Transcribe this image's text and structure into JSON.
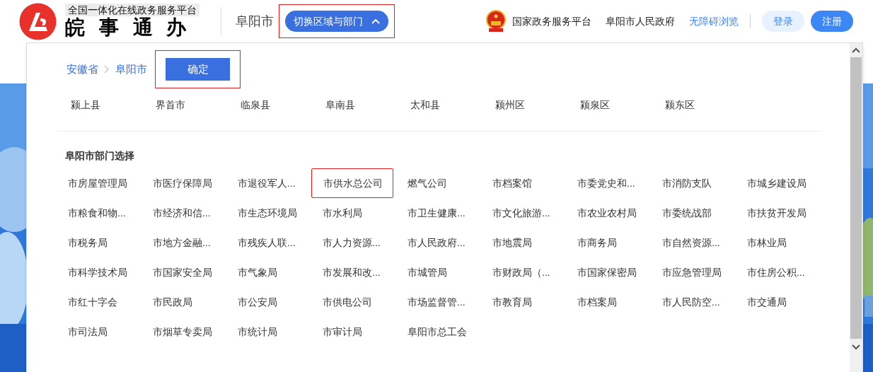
{
  "header": {
    "platform_tagline": "全国一体化在线政务服务平台",
    "brand": "皖 事 通 办",
    "current_city": "阜阳市",
    "switch_button": {
      "label": "切换区域与部门",
      "expanded": true,
      "highlighted": true
    },
    "links": [
      {
        "label": "国家政务服务平台",
        "kind": "emblem"
      },
      {
        "label": "阜阳市人民政府",
        "kind": "plain"
      },
      {
        "label": "无障碍浏览",
        "kind": "accent"
      }
    ],
    "login": "登录",
    "register": "注册"
  },
  "dropdown": {
    "breadcrumb": [
      "安徽省",
      "阜阳市"
    ],
    "confirm": {
      "label": "确定",
      "highlighted": true
    },
    "districts": [
      "颍上县",
      "界首市",
      "临泉县",
      "阜南县",
      "太和县",
      "颍州区",
      "颍泉区",
      "颍东区"
    ],
    "department_title": "阜阳市部门选择",
    "departments": [
      {
        "label": "市房屋管理局",
        "highlighted": false
      },
      {
        "label": "市医疗保障局",
        "highlighted": false
      },
      {
        "label": "市退役军人...",
        "highlighted": false
      },
      {
        "label": "市供水总公司",
        "highlighted": true
      },
      {
        "label": "燃气公司",
        "highlighted": false
      },
      {
        "label": "市档案馆",
        "highlighted": false
      },
      {
        "label": "市委党史和...",
        "highlighted": false
      },
      {
        "label": "市消防支队",
        "highlighted": false
      },
      {
        "label": "市城乡建设局",
        "highlighted": false
      },
      {
        "label": "市粮食和物...",
        "highlighted": false
      },
      {
        "label": "市经济和信...",
        "highlighted": false
      },
      {
        "label": "市生态环境局",
        "highlighted": false
      },
      {
        "label": "市水利局",
        "highlighted": false
      },
      {
        "label": "市卫生健康...",
        "highlighted": false
      },
      {
        "label": "市文化旅游...",
        "highlighted": false
      },
      {
        "label": "市农业农村局",
        "highlighted": false
      },
      {
        "label": "市委统战部",
        "highlighted": false
      },
      {
        "label": "市扶贫开发局",
        "highlighted": false
      },
      {
        "label": "市税务局",
        "highlighted": false
      },
      {
        "label": "市地方金融...",
        "highlighted": false
      },
      {
        "label": "市残疾人联...",
        "highlighted": false
      },
      {
        "label": "市人力资源...",
        "highlighted": false
      },
      {
        "label": "市人民政府...",
        "highlighted": false
      },
      {
        "label": "市地震局",
        "highlighted": false
      },
      {
        "label": "市商务局",
        "highlighted": false
      },
      {
        "label": "市自然资源...",
        "highlighted": false
      },
      {
        "label": "市林业局",
        "highlighted": false
      },
      {
        "label": "市科学技术局",
        "highlighted": false
      },
      {
        "label": "市国家安全局",
        "highlighted": false
      },
      {
        "label": "市气象局",
        "highlighted": false
      },
      {
        "label": "市发展和改...",
        "highlighted": false
      },
      {
        "label": "市城管局",
        "highlighted": false
      },
      {
        "label": "市财政局（...",
        "highlighted": false
      },
      {
        "label": "市国家保密局",
        "highlighted": false
      },
      {
        "label": "市应急管理局",
        "highlighted": false
      },
      {
        "label": "市住房公积...",
        "highlighted": false
      },
      {
        "label": "市红十字会",
        "highlighted": false
      },
      {
        "label": "市民政局",
        "highlighted": false
      },
      {
        "label": "市公安局",
        "highlighted": false
      },
      {
        "label": "市供电公司",
        "highlighted": false
      },
      {
        "label": "市场监督管...",
        "highlighted": false
      },
      {
        "label": "市教育局",
        "highlighted": false
      },
      {
        "label": "市档案局",
        "highlighted": false
      },
      {
        "label": "市人民防空...",
        "highlighted": false
      },
      {
        "label": "市交通局",
        "highlighted": false
      },
      {
        "label": "市司法局",
        "highlighted": false
      },
      {
        "label": "市烟草专卖局",
        "highlighted": false
      },
      {
        "label": "市统计局",
        "highlighted": false
      },
      {
        "label": "市审计局",
        "highlighted": false
      },
      {
        "label": "阜阳市总工会",
        "highlighted": false
      }
    ]
  }
}
